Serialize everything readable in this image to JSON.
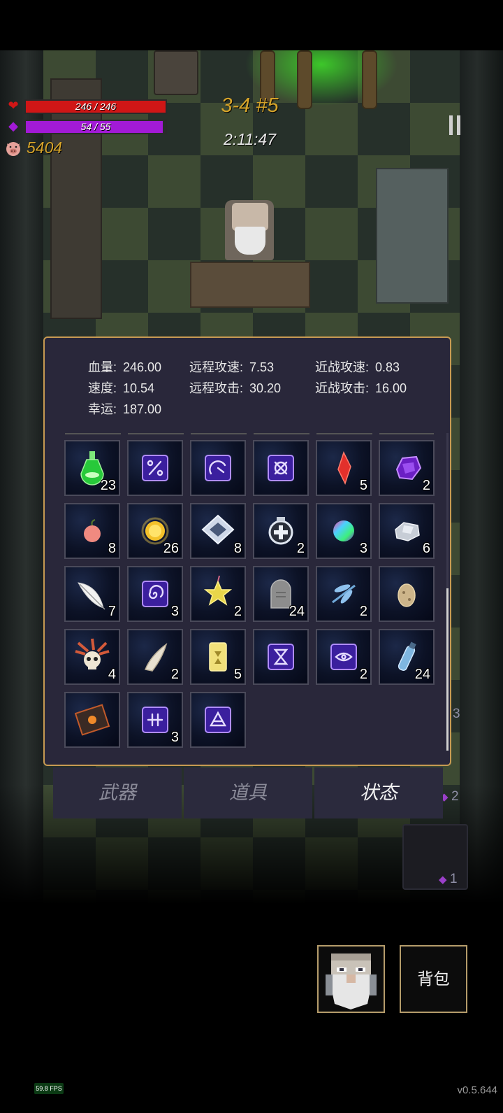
{
  "hud": {
    "hp_text": "246 / 246",
    "hp_fraction": 1.0,
    "mp_text": "54 / 55",
    "mp_fraction": 0.98,
    "gold": "5404",
    "stage": "3-4 #5",
    "timer": "2:11:47",
    "colors": {
      "hp": "#d01616",
      "mp": "#a21ad6",
      "gold": "#d6a42a"
    }
  },
  "side_items": {
    "count_a": "3",
    "count_b": "2",
    "count_c": "1"
  },
  "stats": [
    {
      "label": "血量:",
      "value": "246.00"
    },
    {
      "label": "远程攻速:",
      "value": "7.53"
    },
    {
      "label": "近战攻速:",
      "value": "0.83"
    },
    {
      "label": "速度:",
      "value": "10.54"
    },
    {
      "label": "远程攻击:",
      "value": "30.20"
    },
    {
      "label": "近战攻击:",
      "value": "16.00"
    },
    {
      "label": "幸运:",
      "value": "187.00"
    }
  ],
  "inventory": [
    {
      "icon": "green-potion-icon",
      "count": "23"
    },
    {
      "icon": "rune-percent-icon",
      "count": ""
    },
    {
      "icon": "rune-arc-icon",
      "count": ""
    },
    {
      "icon": "rune-cross-circle-icon",
      "count": ""
    },
    {
      "icon": "red-crystal-icon",
      "count": "5"
    },
    {
      "icon": "purple-gem-icon",
      "count": "2"
    },
    {
      "icon": "peach-icon",
      "count": "8"
    },
    {
      "icon": "gold-coin-icon",
      "count": "26"
    },
    {
      "icon": "silver-lattice-icon",
      "count": "8"
    },
    {
      "icon": "shield-ring-icon",
      "count": "2"
    },
    {
      "icon": "rainbow-orb-icon",
      "count": "3"
    },
    {
      "icon": "silver-ore-icon",
      "count": "6"
    },
    {
      "icon": "feather-icon",
      "count": "7"
    },
    {
      "icon": "rune-spiral-icon",
      "count": "3"
    },
    {
      "icon": "yellow-star-fruit-icon",
      "count": "2"
    },
    {
      "icon": "tombstone-icon",
      "count": "24"
    },
    {
      "icon": "dragonfly-icon",
      "count": "2"
    },
    {
      "icon": "egg-icon",
      "count": ""
    },
    {
      "icon": "feathered-skull-icon",
      "count": "4"
    },
    {
      "icon": "horn-icon",
      "count": "2"
    },
    {
      "icon": "yellow-card-icon",
      "count": "5"
    },
    {
      "icon": "rune-hourglass-icon",
      "count": ""
    },
    {
      "icon": "rune-eye-icon",
      "count": "2"
    },
    {
      "icon": "blue-vial-icon",
      "count": "24"
    },
    {
      "icon": "spellbook-icon",
      "count": ""
    },
    {
      "icon": "rune-hash-icon",
      "count": "3"
    },
    {
      "icon": "rune-triangle-icon",
      "count": ""
    }
  ],
  "tabs": [
    {
      "label": "武器",
      "active": false
    },
    {
      "label": "道具",
      "active": false
    },
    {
      "label": "状态",
      "active": true
    }
  ],
  "backpack_label": "背包",
  "fps": "59.8 FPS",
  "version": "v0.5.644"
}
